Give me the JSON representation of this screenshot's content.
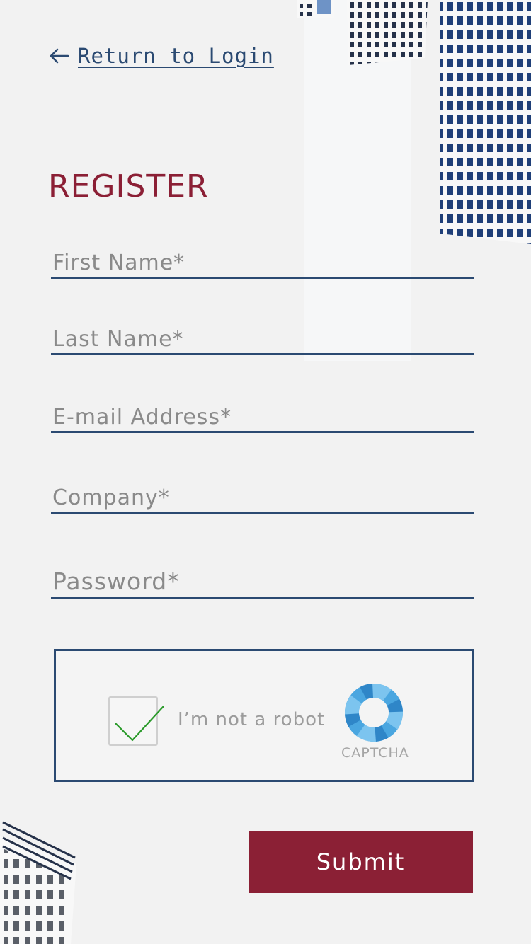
{
  "nav": {
    "back_label": "Return to Login"
  },
  "form": {
    "title": "REGISTER",
    "fields": [
      {
        "placeholder": "First Name*",
        "value": ""
      },
      {
        "placeholder": "Last Name*",
        "value": ""
      },
      {
        "placeholder": "E-mail Address*",
        "value": ""
      },
      {
        "placeholder": "Company*",
        "value": ""
      },
      {
        "placeholder": "Password*",
        "value": ""
      }
    ],
    "submit_label": "Submit"
  },
  "captcha": {
    "label": "I’m not a robot",
    "brand": "CAPTCHA",
    "checked": true
  },
  "icons": {
    "back": "arrow-left-icon",
    "check": "checkmark-icon",
    "captcha": "captcha-logo-icon"
  },
  "colors": {
    "background": "#f2f2f2",
    "accent_red": "#8b2035",
    "navy": "#2b4a72",
    "check_green": "#2a9a2a",
    "captcha_blue": "#3a9ad9"
  }
}
